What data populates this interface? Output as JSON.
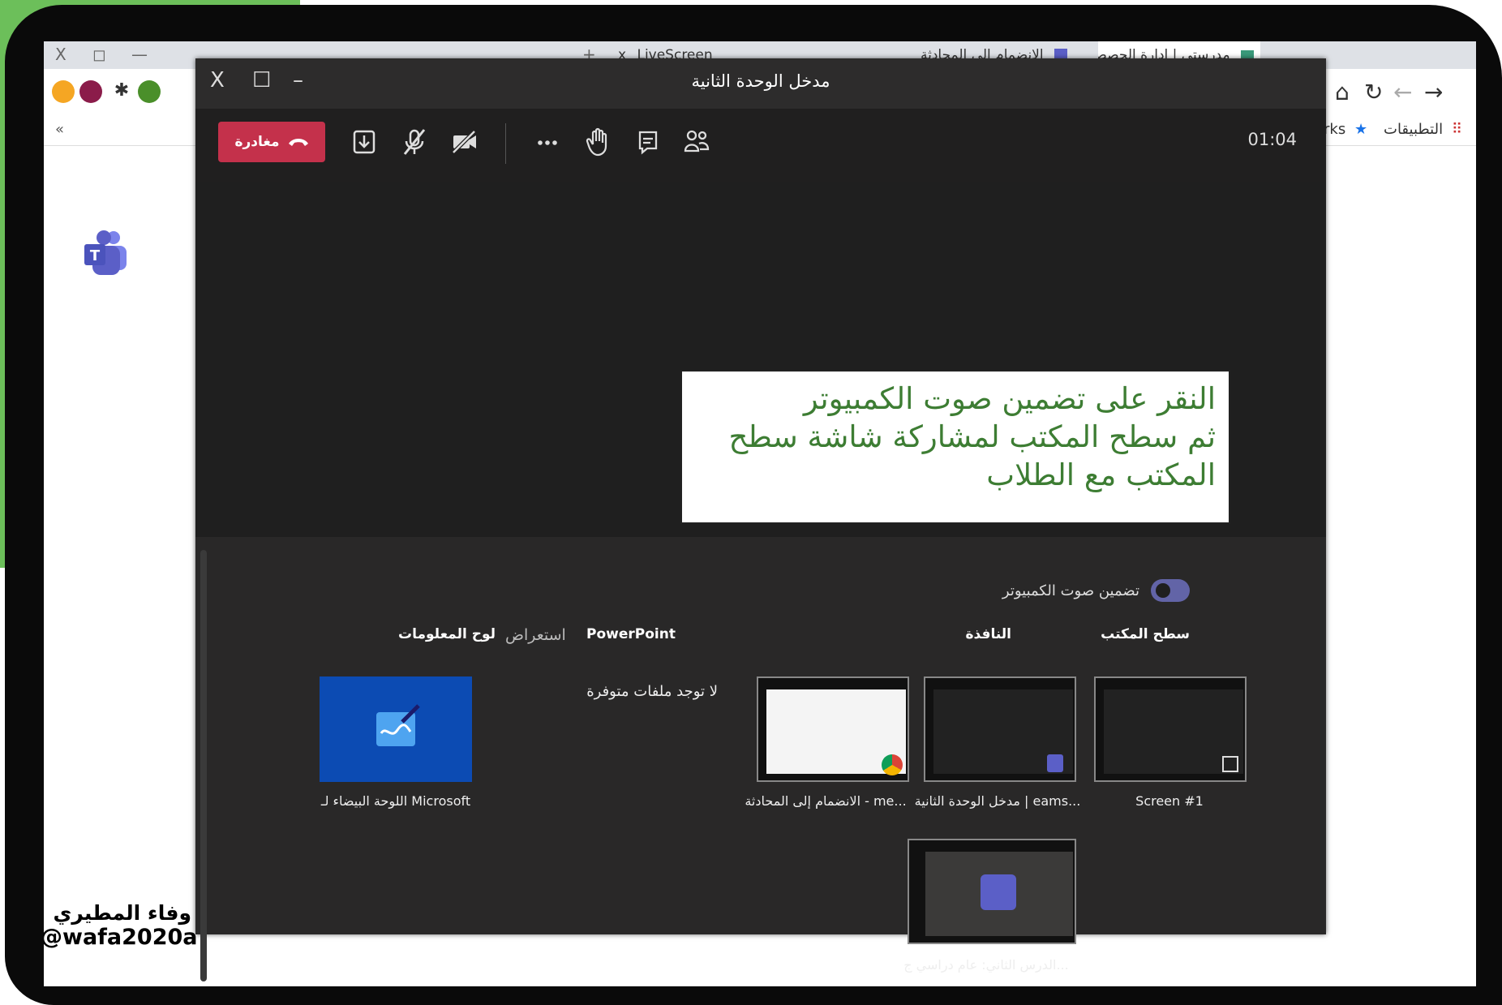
{
  "browser": {
    "tabs": [
      {
        "label": "LiveScreen"
      },
      {
        "label": "الانضمام إلى المحادثة"
      },
      {
        "label": "مدرستي | إدارة الحصص"
      }
    ],
    "window_controls": {
      "close": "X",
      "restore": "◻",
      "minimize": "—"
    },
    "new_tab": "+",
    "tab_close": "x",
    "bookmarks": {
      "apps_label": "التطبيقات",
      "bookmarks_label": "rks",
      "more": "«"
    }
  },
  "teams_window": {
    "title": "مدخل الوحدة الثانية",
    "controls": {
      "close": "X",
      "maximize": "☐",
      "minimize": "–"
    },
    "leave_label": "مغادرة",
    "timer": "01:04"
  },
  "callout": {
    "line1": "النقر على تضمين صوت الكمبيوتر",
    "line2": "ثم سطح المكتب لمشاركة شاشة سطح",
    "line3": "المكتب مع الطلاب"
  },
  "share_tray": {
    "include_audio_label": "تضمين صوت الكمبيوتر",
    "include_audio_on": true,
    "headers": {
      "desktop": "سطح المكتب",
      "window": "النافذة",
      "powerpoint": "PowerPoint",
      "browse": "استعراض",
      "whiteboard": "لوح المعلومات"
    },
    "thumbnails": [
      {
        "label": "Screen #1"
      },
      {
        "label": "مدخل الوحدة الثانية | eams..."
      },
      {
        "label": "الانضمام إلى المحادثة - me..."
      },
      {
        "label": "الدرس الثاني: عام دراسي ج..."
      }
    ],
    "no_files": "لا توجد ملفات متوفرة",
    "whiteboard_label": "اللوحة البيضاء لـ Microsoft"
  },
  "watermark": {
    "name": "وفاء المطيري",
    "handle": "@wafa2020a"
  },
  "colors": {
    "leave": "#c4314b",
    "toggle": "#6264a7",
    "callout_text": "#3d7d33",
    "whiteboard": "#0c4bb3",
    "teams": "#5b5fc7"
  }
}
